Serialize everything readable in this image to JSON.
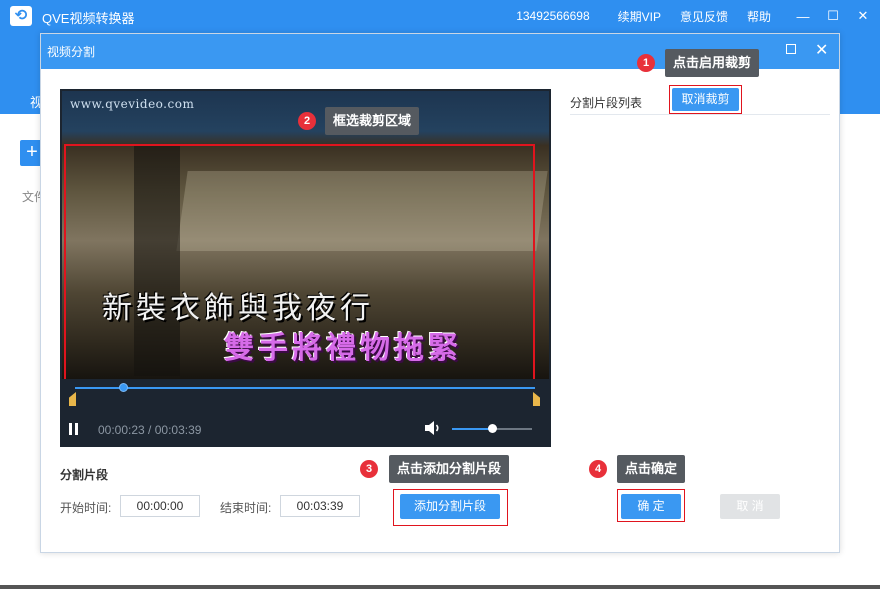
{
  "app": {
    "title": "QVE视频转换器",
    "phone": "13492566698",
    "renew_vip": "续期VIP",
    "feedback": "意见反馈",
    "help": "帮助",
    "tab_partial": "视",
    "add_partial": "+",
    "file_partial": "文件"
  },
  "dialog": {
    "title": "视频分割",
    "player": {
      "watermark": "www.qvevideo.com",
      "subtitle_line1": "新裝衣飾與我夜行",
      "subtitle_line2": "雙手將禮物拖緊",
      "current_time": "00:00:23",
      "separator": " / ",
      "total_time": "00:03:39",
      "progress": 0.105,
      "volume": 0.5
    },
    "segment_list_label": "分割片段列表",
    "cancel_crop_button": "取消裁剪",
    "segment_section_title": "分割片段",
    "start_time_label": "开始时间:",
    "start_time_value": "00:00:00",
    "end_time_label": "结束时间:",
    "end_time_value": "00:03:39",
    "add_segment_button": "添加分割片段",
    "confirm_button": "确 定",
    "cancel_button": "取 消"
  },
  "callouts": [
    {
      "number": "1",
      "text": "点击启用裁剪"
    },
    {
      "number": "2",
      "text": "框选裁剪区域"
    },
    {
      "number": "3",
      "text": "点击添加分割片段"
    },
    {
      "number": "4",
      "text": "点击确定"
    }
  ],
  "colors": {
    "primary_blue": "#3a98f2",
    "titlebar_blue": "#2f8ff0",
    "highlight_red": "#e0141e",
    "badge_red": "#e8303a",
    "tooltip_gray": "#555a60"
  }
}
